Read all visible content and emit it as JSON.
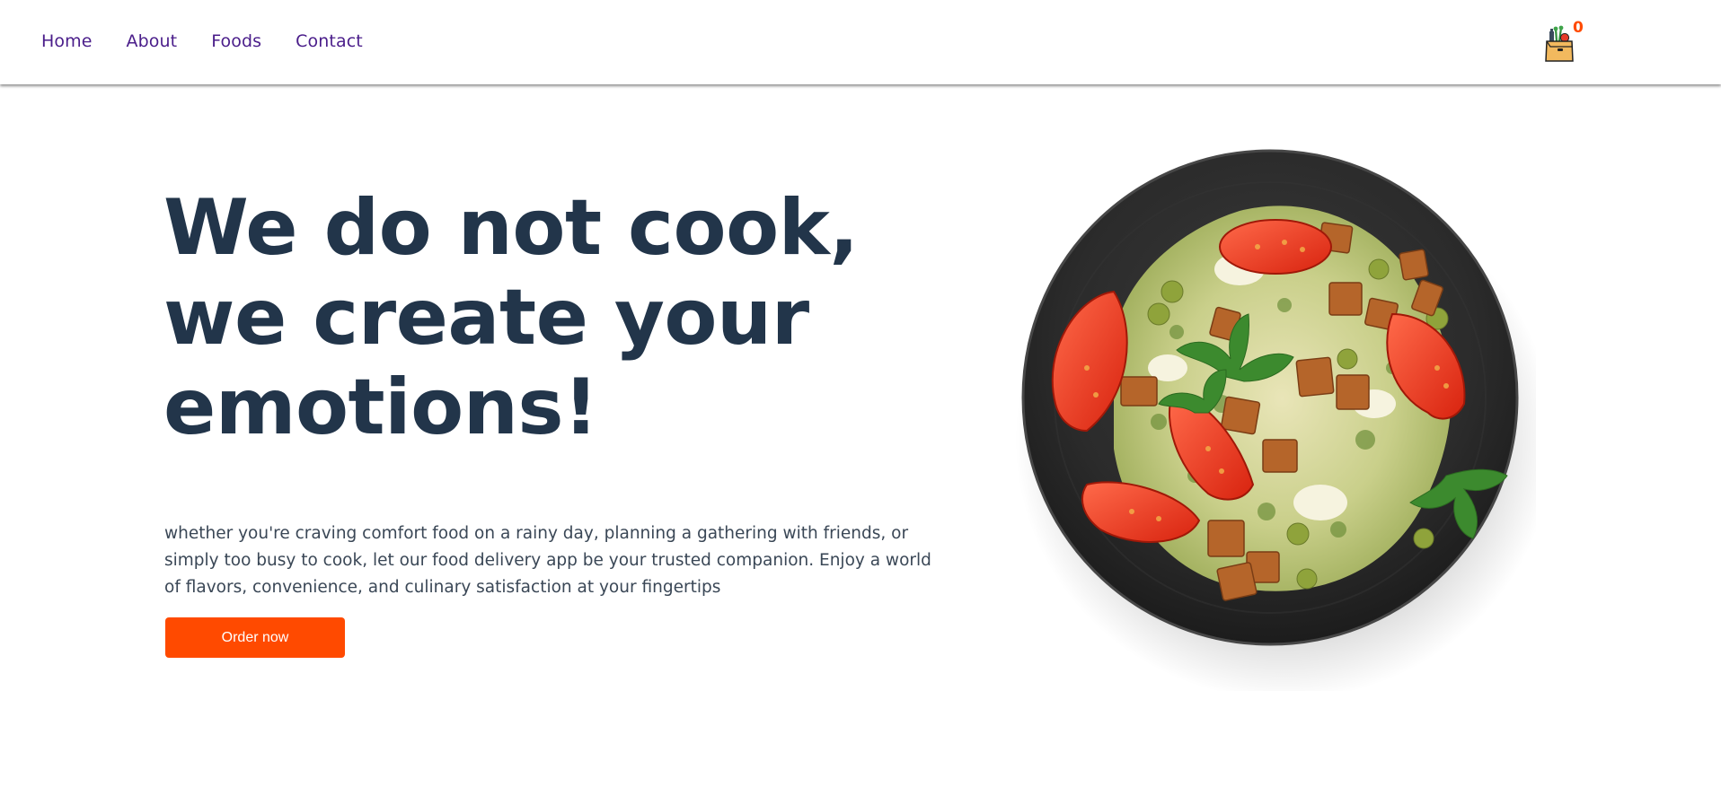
{
  "nav": {
    "links": [
      "Home",
      "About",
      "Foods",
      "Contact"
    ]
  },
  "cart": {
    "icon": "shopping-bag-icon",
    "count": "0"
  },
  "hero": {
    "title_lines": [
      "We do not cook,",
      "we create your",
      "emotions!"
    ],
    "description": "whether you're craving comfort food on a rainy day, planning a gathering with friends, or simply too busy to cook, let our food delivery app be your trusted companion. Enjoy a world of flavors, convenience, and culinary satisfaction at your fingertips",
    "cta_label": "Order now"
  },
  "colors": {
    "nav_link": "#4a1d8a",
    "title": "#22354a",
    "accent": "#ff4a00"
  }
}
